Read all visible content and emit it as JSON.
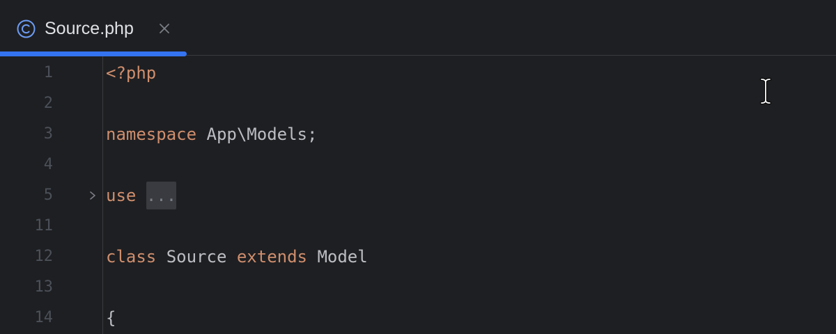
{
  "tab": {
    "title": "Source.php",
    "icon": "class-c-icon",
    "accent": "#3574f0"
  },
  "lines": [
    {
      "number": "1",
      "code": [
        {
          "text": "<?php",
          "type": "keyword"
        }
      ]
    },
    {
      "number": "2",
      "code": []
    },
    {
      "number": "3",
      "code": [
        {
          "text": "namespace",
          "type": "keyword"
        },
        {
          "text": " App\\Models;",
          "type": "plain"
        }
      ]
    },
    {
      "number": "4",
      "code": []
    },
    {
      "number": "5",
      "code": [
        {
          "text": "use",
          "type": "keyword"
        },
        {
          "text": " ",
          "type": "plain"
        },
        {
          "text": "...",
          "type": "folded"
        }
      ],
      "foldable": true
    },
    {
      "number": "11",
      "code": []
    },
    {
      "number": "12",
      "code": [
        {
          "text": "class",
          "type": "keyword"
        },
        {
          "text": " Source ",
          "type": "plain"
        },
        {
          "text": "extends",
          "type": "keyword"
        },
        {
          "text": " Model",
          "type": "plain"
        }
      ]
    },
    {
      "number": "13",
      "code": []
    },
    {
      "number": "14",
      "code": [
        {
          "text": "{",
          "type": "plain"
        }
      ]
    }
  ],
  "colors": {
    "background": "#1e1f22",
    "keyword": "#cf8e6d",
    "text": "#bcbec4",
    "line_number": "#4b5059"
  }
}
